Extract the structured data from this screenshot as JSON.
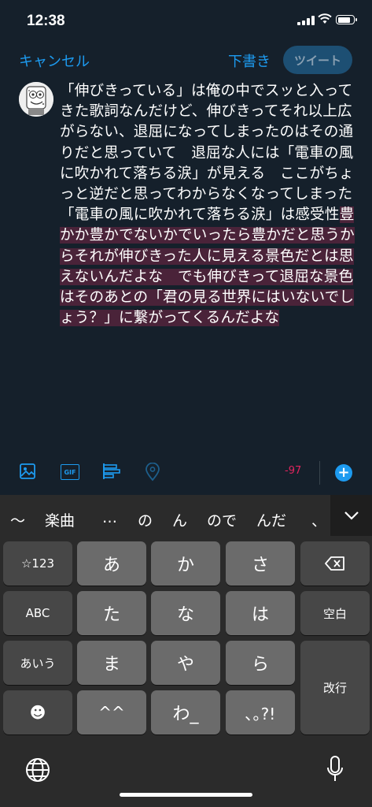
{
  "status_bar": {
    "time": "12:38"
  },
  "header": {
    "cancel_label": "キャンセル",
    "draft_label": "下書き",
    "tweet_label": "ツイート"
  },
  "compose": {
    "text_normal": "「伸びきっている」は俺の中でスッと入ってきた歌詞なんだけど、伸びきってそれ以上広がらない、退屈になってしまったのはその通りだと思っていて　退屈な人には「電車の風に吹かれて落ちる涙」が見える　ここがちょっと逆だと思ってわからなくなってしまった　「電車の風に吹かれて落ちる涙」は感受性",
    "text_over_limit": "豊かか豊かでないかでいったら豊かだと思うからそれが伸びきった人に見える景色だとは思えないんだよな　でも伸びきって退屈な景色はそのあとの「君の見る世界にはいないでしょう？」に繋がってくるんだよな"
  },
  "toolbar": {
    "char_count": "-97",
    "gif_label": "GIF",
    "add_label": "+"
  },
  "keyboard": {
    "candidates": [
      "〜",
      "楽曲",
      "…",
      "の",
      "ん",
      "ので",
      "んだ",
      "、"
    ],
    "rows": {
      "r1": [
        "☆123",
        "あ",
        "か",
        "さ"
      ],
      "r2": [
        "ABC",
        "た",
        "な",
        "は",
        "空白"
      ],
      "r3": [
        "あいう",
        "ま",
        "や",
        "ら",
        "改行"
      ],
      "r4": [
        "☻",
        "^^",
        "わ_",
        "､｡?!"
      ]
    }
  },
  "colors": {
    "background": "#15202b",
    "accent": "#1d9bf0",
    "over_limit": "#e0245e"
  }
}
